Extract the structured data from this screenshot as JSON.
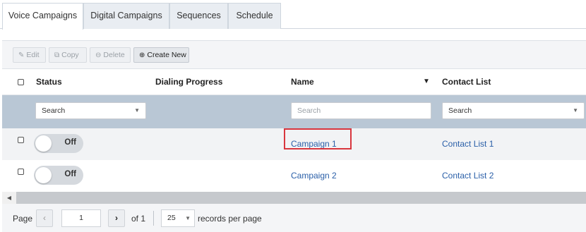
{
  "tabs": [
    {
      "label": "Voice Campaigns",
      "active": true
    },
    {
      "label": "Digital Campaigns",
      "active": false
    },
    {
      "label": "Sequences",
      "active": false
    },
    {
      "label": "Schedule",
      "active": false
    }
  ],
  "toolbar": {
    "edit_label": "Edit",
    "copy_label": "Copy",
    "delete_label": "Delete",
    "create_label": "Create New"
  },
  "columns": {
    "status": "Status",
    "dialing_progress": "Dialing Progress",
    "name": "Name",
    "contact_list": "Contact List"
  },
  "filters": {
    "status_value": "Search",
    "name_placeholder": "Search",
    "contact_list_value": "Search"
  },
  "rows": [
    {
      "status": "Off",
      "name": "Campaign 1",
      "contact_list": "Contact List 1"
    },
    {
      "status": "Off",
      "name": "Campaign 2",
      "contact_list": "Contact List 2"
    }
  ],
  "pager": {
    "page_label": "Page",
    "current_page": "1",
    "of_label": "of 1",
    "page_size": "25",
    "records_label": "records per page"
  },
  "colors": {
    "accent_link": "#2a5fa8",
    "filter_row_bg": "#b9c7d5",
    "highlight_border": "#d9363e"
  }
}
